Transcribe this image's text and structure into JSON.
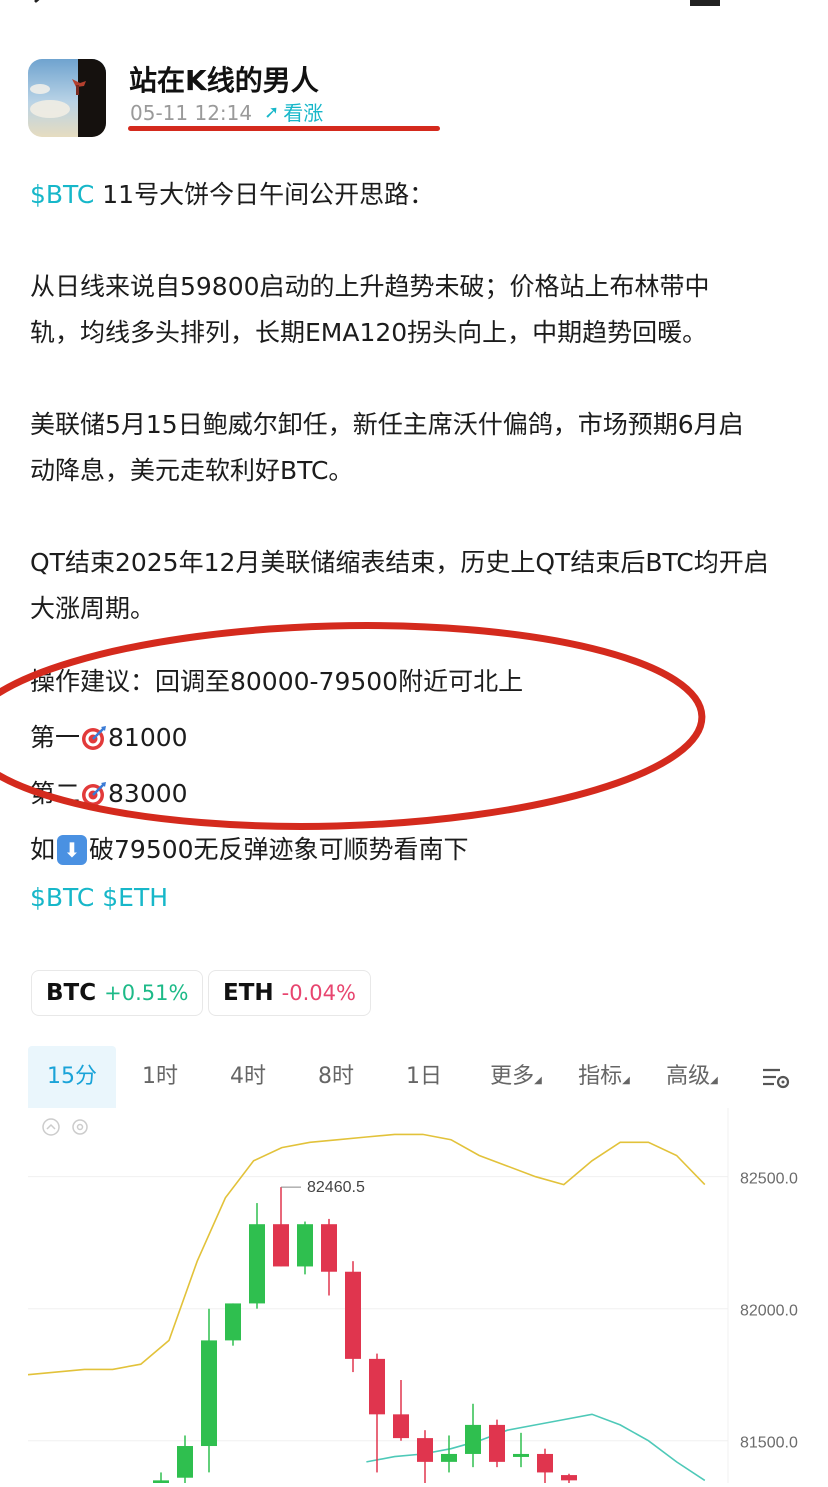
{
  "author": {
    "name": "站在K线的男人",
    "time": "05-11 12:14",
    "sentiment": "看涨"
  },
  "post": {
    "line1_ticker": "$BTC",
    "line1_text": " 11号大饼今日午间公开思路：",
    "para2_line1": "从日线来说自59800启动的上升趋势未破；价格站上布林带中",
    "para2_line2": "轨，均线多头排列，长期EMA120拐头向上，中期趋势回暖。",
    "para3_line1": "美联储5月15日鲍威尔卸任，新任主席沃什偏鸽，市场预期6月启",
    "para3_line2": "动降息，美元走软利好BTC。",
    "para4_line1": "QT结束2025年12月美联储缩表结束，历史上QT结束后BTC均开启",
    "para4_line2": "大涨周期。",
    "advice": "操作建议：回调至80000-79500附近可北上",
    "target1_prefix": "第一",
    "target1_value": "81000",
    "target2_prefix": "第二",
    "target2_value": "83000",
    "breakdown_prefix": "如",
    "breakdown_text": "破79500无反弹迹象可顺势看南下",
    "tags": "$BTC $ETH"
  },
  "icons": {
    "target": "dart-target-icon",
    "down": "down-arrow-icon"
  },
  "tickers": [
    {
      "symbol": "BTC",
      "change": "+0.51%"
    },
    {
      "symbol": "ETH",
      "change": "-0.04%"
    }
  ],
  "chart_tabs": [
    "15分",
    "1时",
    "4时",
    "8时",
    "1日",
    "更多",
    "指标",
    "高级"
  ],
  "active_tab": "15分",
  "colors": {
    "accent": "#17b7c9",
    "up": "#1dba88",
    "down": "#e8456f",
    "annotation_red": "#d42a1d",
    "candle_up": "#2fbf4f",
    "candle_down": "#e0354e",
    "upper_band": "#e2c23a",
    "lower_band": "#4ec9b8"
  },
  "chart_data": {
    "type": "candlestick",
    "price_labels": [
      "82500.0",
      "82000.0",
      "81500.0"
    ],
    "y_ticks": [
      82500.0,
      82000.0,
      81500.0
    ],
    "high_label": "82460.5",
    "ylim": [
      81340,
      82760
    ],
    "candles": [
      {
        "o": 81340,
        "h": 81380,
        "c": 81350,
        "l": 81320
      },
      {
        "o": 81360,
        "h": 81520,
        "c": 81480,
        "l": 81340
      },
      {
        "o": 81480,
        "h": 82000,
        "c": 81880,
        "l": 81380
      },
      {
        "o": 81880,
        "h": 82020,
        "c": 82020,
        "l": 81860
      },
      {
        "o": 82020,
        "h": 82400,
        "c": 82320,
        "l": 82000
      },
      {
        "o": 82320,
        "h": 82460.5,
        "c": 82160,
        "l": 82200
      },
      {
        "o": 82160,
        "h": 82330,
        "c": 82320,
        "l": 82130
      },
      {
        "o": 82320,
        "h": 82340,
        "c": 82140,
        "l": 82050
      },
      {
        "o": 82140,
        "h": 82180,
        "c": 81810,
        "l": 81760
      },
      {
        "o": 81810,
        "h": 81830,
        "c": 81600,
        "l": 81380
      },
      {
        "o": 81600,
        "h": 81730,
        "c": 81510,
        "l": 81500
      },
      {
        "o": 81510,
        "h": 81540,
        "c": 81420,
        "l": 81340
      },
      {
        "o": 81420,
        "h": 81520,
        "c": 81450,
        "l": 81380
      },
      {
        "o": 81450,
        "h": 81640,
        "c": 81560,
        "l": 81400
      },
      {
        "o": 81560,
        "h": 81580,
        "c": 81420,
        "l": 81400
      },
      {
        "o": 81440,
        "h": 81530,
        "c": 81450,
        "l": 81400
      },
      {
        "o": 81450,
        "h": 81470,
        "c": 81380,
        "l": 81340
      },
      {
        "o": 81370,
        "h": 81375,
        "c": 81350,
        "l": 81340
      }
    ],
    "upper_band": [
      81750,
      81760,
      81770,
      81770,
      81790,
      81880,
      82180,
      82420,
      82560,
      82610,
      82630,
      82640,
      82650,
      82660,
      82660,
      82640,
      82580,
      82540,
      82500,
      82470,
      82560,
      82630,
      82630,
      82580,
      82470
    ],
    "lower_band": [
      null,
      null,
      null,
      null,
      null,
      null,
      null,
      null,
      null,
      null,
      null,
      null,
      81420,
      81440,
      81450,
      81470,
      81500,
      81540,
      81560,
      81580,
      81600,
      81560,
      81500,
      81420,
      81350
    ]
  }
}
